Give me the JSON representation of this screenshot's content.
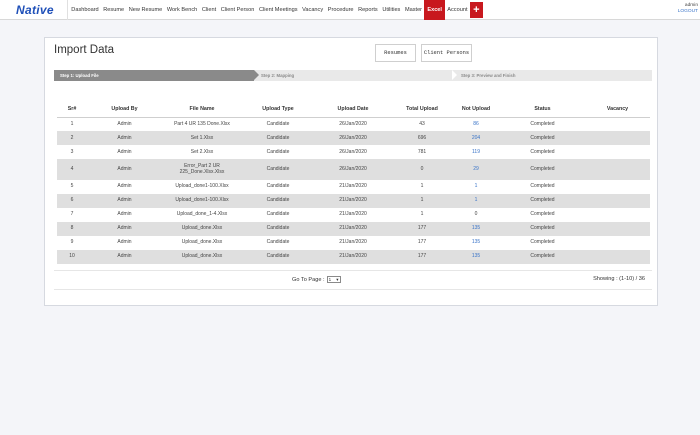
{
  "app": {
    "logo": "Native"
  },
  "nav": {
    "items": [
      "Dashboard",
      "Resume",
      "New Resume",
      "Work Bench",
      "Client",
      "Client Person",
      "Client Meetings",
      "Vacancy",
      "Procedure",
      "Reports",
      "Utilities",
      "Master",
      "Excel",
      "Account"
    ],
    "active": "Excel",
    "plus": "+"
  },
  "user": {
    "name": "admin",
    "logout": "LOGOUT"
  },
  "page": {
    "title": "Import Data",
    "buttons": {
      "resumes": "Resumes",
      "client_persons": "Client Persons"
    }
  },
  "steps": {
    "step1": "Step 1: Upload File",
    "step2": "Step 2: Mapping",
    "step3": "Step 3: Preview and Finish"
  },
  "table": {
    "headers": [
      "Sr#",
      "Upload By",
      "File Name",
      "Upload Type",
      "Upload Date",
      "Total Upload",
      "Not Upload",
      "Status",
      "Vacancy"
    ],
    "rows": [
      [
        "1",
        "Admin",
        "Part 4 UR 135 Done.Xlsx",
        "Candidate",
        "26/Jan/2020",
        "43",
        "86",
        "Completed",
        ""
      ],
      [
        "2",
        "Admin",
        "Set 1.Xlsx",
        "Candidate",
        "26/Jan/2020",
        "696",
        "204",
        "Completed",
        ""
      ],
      [
        "3",
        "Admin",
        "Set 2.Xlsx",
        "Candidate",
        "26/Jan/2020",
        "781",
        "119",
        "Completed",
        ""
      ],
      [
        "4",
        "Admin",
        "Error_Part 2 UR 225_Done.Xlsx.Xlsx",
        "Candidate",
        "26/Jan/2020",
        "0",
        "29",
        "Completed",
        ""
      ],
      [
        "5",
        "Admin",
        "Upload_done1-100.Xlsx",
        "Candidate",
        "21/Jan/2020",
        "1",
        "1",
        "Completed",
        ""
      ],
      [
        "6",
        "Admin",
        "Upload_done1-100.Xlsx",
        "Candidate",
        "21/Jan/2020",
        "1",
        "1",
        "Completed",
        ""
      ],
      [
        "7",
        "Admin",
        "Upload_done_1-4.Xlsx",
        "Candidate",
        "21/Jan/2020",
        "1",
        "0",
        "Completed",
        ""
      ],
      [
        "8",
        "Admin",
        "Upload_done.Xlsx",
        "Candidate",
        "21/Jan/2020",
        "177",
        "135",
        "Completed",
        ""
      ],
      [
        "9",
        "Admin",
        "Upload_done.Xlsx",
        "Candidate",
        "21/Jan/2020",
        "177",
        "135",
        "Completed",
        ""
      ],
      [
        "10",
        "Admin",
        "Upload_done.Xlsx",
        "Candidate",
        "21/Jan/2020",
        "177",
        "135",
        "Completed",
        ""
      ]
    ]
  },
  "pager": {
    "goto_label": "Go To Page :",
    "selected_page": "1",
    "showing": "Showing : (1-10) / 36"
  }
}
